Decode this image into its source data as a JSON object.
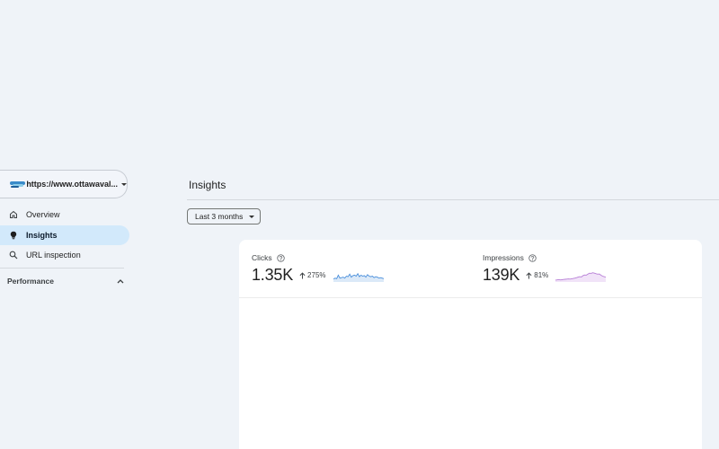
{
  "property": {
    "url": "https://www.ottawaval...",
    "logo_colors": [
      "#3a8bc9",
      "#8ecde8",
      "#1f5f99"
    ]
  },
  "nav": {
    "items": [
      {
        "label": "Overview",
        "icon": "home-icon",
        "active": false
      },
      {
        "label": "Insights",
        "icon": "lightbulb-icon",
        "active": true
      },
      {
        "label": "URL inspection",
        "icon": "search-icon",
        "active": false
      }
    ],
    "section": {
      "label": "Performance",
      "expanded": true,
      "icon": "chevron-up-icon"
    }
  },
  "main": {
    "title": "Insights",
    "date_range": "Last 3 months"
  },
  "metrics": [
    {
      "label": "Clicks",
      "value": "1.35K",
      "change": "275%",
      "direction": "up",
      "color": "#4a8fdb",
      "fill": "#dbe9f8",
      "trend": [
        0.2,
        0.3,
        0.25,
        0.6,
        0.3,
        0.35,
        0.4,
        0.3,
        0.5,
        0.45,
        0.7,
        0.4,
        0.55,
        0.6,
        0.5,
        0.75,
        0.45,
        0.6,
        0.5,
        0.55,
        0.4,
        0.65,
        0.5,
        0.45,
        0.5,
        0.35,
        0.45,
        0.4,
        0.3,
        0.35,
        0.3,
        0.25
      ]
    },
    {
      "label": "Impressions",
      "value": "139K",
      "change": "81%",
      "direction": "up",
      "color": "#b77fd6",
      "fill": "#f1e3f8",
      "trend": [
        0.1,
        0.12,
        0.15,
        0.12,
        0.14,
        0.16,
        0.18,
        0.2,
        0.22,
        0.2,
        0.24,
        0.26,
        0.3,
        0.35,
        0.4,
        0.45,
        0.42,
        0.55,
        0.62,
        0.6,
        0.7,
        0.8,
        0.78,
        0.85,
        0.8,
        0.75,
        0.7,
        0.72,
        0.6,
        0.5,
        0.45,
        0.4
      ]
    }
  ]
}
